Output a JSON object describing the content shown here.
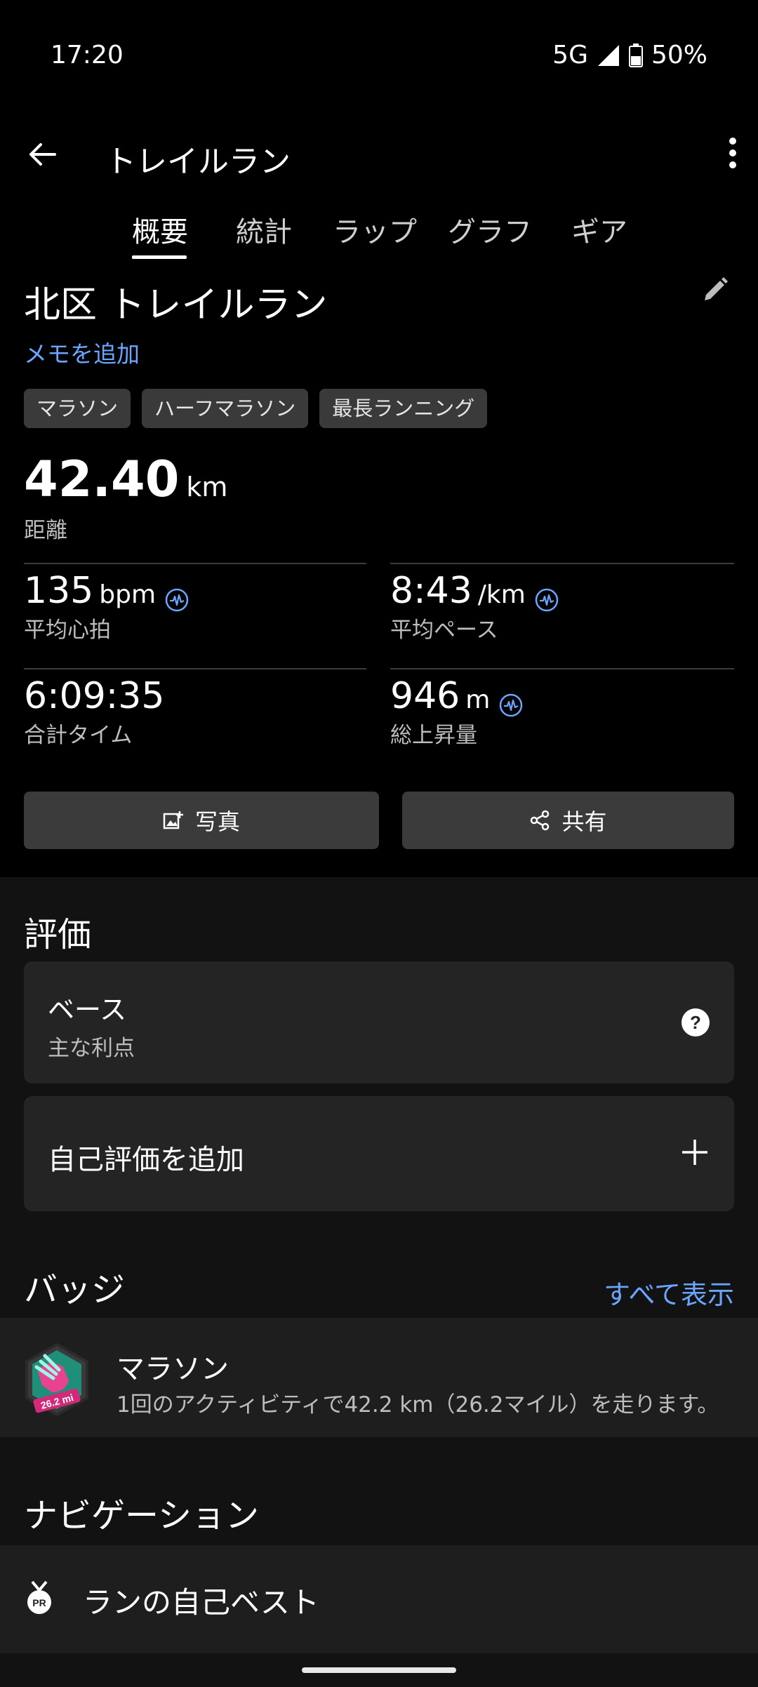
{
  "status": {
    "time": "17:20",
    "network": "5G",
    "battery": "50%"
  },
  "appbar": {
    "title": "トレイルラン"
  },
  "tabs": [
    "概要",
    "統計",
    "ラップ",
    "グラフ",
    "ギア"
  ],
  "activity": {
    "title": "北区 トレイルラン",
    "add_memo": "メモを追加"
  },
  "chips": [
    "マラソン",
    "ハーフマラソン",
    "最長ランニング"
  ],
  "distance": {
    "value": "42.40",
    "unit": "km",
    "label": "距離"
  },
  "stats": {
    "hr": {
      "value": "135",
      "unit": "bpm",
      "label": "平均心拍"
    },
    "pace": {
      "value": "8:43",
      "unit": "/km",
      "label": "平均ペース"
    },
    "time": {
      "value": "6:09:35",
      "label": "合計タイム"
    },
    "ascent": {
      "value": "946",
      "unit": "m",
      "label": "総上昇量"
    }
  },
  "buttons": {
    "photo": "写真",
    "share": "共有"
  },
  "evaluation": {
    "title": "評価",
    "base_title": "ベース",
    "base_sub": "主な利点",
    "add_self": "自己評価を追加"
  },
  "badges": {
    "title": "バッジ",
    "show_all": "すべて表示",
    "item_title": "マラソン",
    "item_desc": "1回のアクティビティで42.2 km（26.2マイル）を走ります。",
    "badge_text": "26.2 mi"
  },
  "navigation": {
    "title": "ナビゲーション",
    "item": "ランの自己ベスト",
    "pr": "PR"
  },
  "colors": {
    "accent": "#6aa5ff",
    "background": "#000000",
    "card": "#242424"
  }
}
